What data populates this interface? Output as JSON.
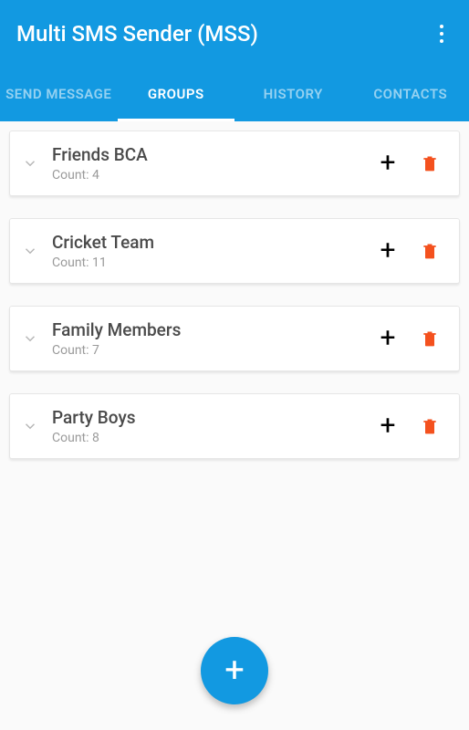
{
  "header": {
    "title": "Multi SMS Sender (MSS)"
  },
  "tabs": [
    {
      "label": "SEND MESSAGE",
      "active": false
    },
    {
      "label": "GROUPS",
      "active": true
    },
    {
      "label": "HISTORY",
      "active": false
    },
    {
      "label": "CONTACTS",
      "active": false
    }
  ],
  "count_prefix": "Count: ",
  "groups": [
    {
      "name": "Friends BCA",
      "count": 4
    },
    {
      "name": "Cricket Team",
      "count": 11
    },
    {
      "name": "Family Members",
      "count": 7
    },
    {
      "name": "Party Boys",
      "count": 8
    }
  ],
  "icons": {
    "menu": "menu-vertical",
    "expand": "chevron-down",
    "add_member": "+",
    "delete": "trash",
    "fab": "+"
  },
  "colors": {
    "primary": "#1299e1",
    "danger": "#f4511e",
    "text": "#4a4a4a",
    "muted": "#9a9a9a"
  }
}
